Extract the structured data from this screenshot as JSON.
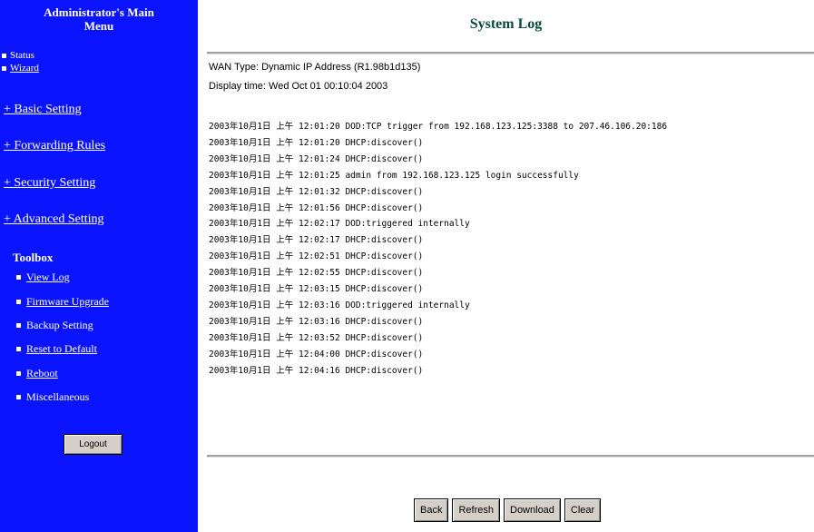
{
  "sidebar": {
    "title_line1": "Administrator's Main",
    "title_line2": "Menu",
    "status_label": "Status",
    "wizard_label": "Wizard",
    "basic_setting": "+ Basic Setting",
    "forwarding_rules": "+ Forwarding Rules",
    "security_setting": "+ Security Setting",
    "advanced_setting": "+ Advanced Setting",
    "toolbox_title": "Toolbox",
    "tools": [
      "View Log",
      "Firmware Upgrade",
      "Backup Setting",
      "Reset to Default",
      "Reboot",
      "Miscellaneous"
    ],
    "logout_label": "Logout"
  },
  "main": {
    "title": "System Log",
    "wan_type": "WAN Type: Dynamic IP Address (R1.98b1d135)",
    "display_time": "Display time: Wed Oct 01 00:10:04 2003",
    "log_lines": [
      "2003年10月1日 上午 12:01:20 DOD:TCP trigger from 192.168.123.125:3388 to 207.46.106.20:186",
      "2003年10月1日 上午 12:01:20 DHCP:discover()",
      "2003年10月1日 上午 12:01:24 DHCP:discover()",
      "2003年10月1日 上午 12:01:25 admin from 192.168.123.125 login successfully",
      "2003年10月1日 上午 12:01:32 DHCP:discover()",
      "2003年10月1日 上午 12:01:56 DHCP:discover()",
      "2003年10月1日 上午 12:02:17 DOD:triggered internally",
      "2003年10月1日 上午 12:02:17 DHCP:discover()",
      "2003年10月1日 上午 12:02:51 DHCP:discover()",
      "2003年10月1日 上午 12:02:55 DHCP:discover()",
      "2003年10月1日 上午 12:03:15 DHCP:discover()",
      "2003年10月1日 上午 12:03:16 DOD:triggered internally",
      "2003年10月1日 上午 12:03:16 DHCP:discover()",
      "2003年10月1日 上午 12:03:52 DHCP:discover()",
      "2003年10月1日 上午 12:04:00 DHCP:discover()",
      "2003年10月1日 上午 12:04:16 DHCP:discover()"
    ],
    "buttons": {
      "back": "Back",
      "refresh": "Refresh",
      "download": "Download",
      "clear": "Clear"
    }
  }
}
